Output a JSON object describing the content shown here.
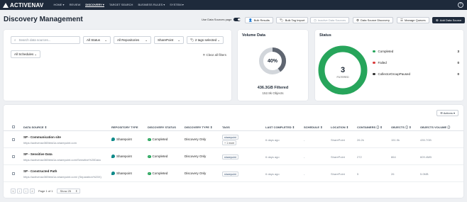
{
  "app": {
    "name": "ACTIVENAV"
  },
  "nav": {
    "items": [
      {
        "label": "HOME ▾"
      },
      {
        "label": "REVIEW"
      },
      {
        "label": "DISCOVERY ▾"
      },
      {
        "label": "TARGET SEARCH"
      },
      {
        "label": "BUSINESS RULES ▾"
      },
      {
        "label": "SYSTEM ▾"
      }
    ],
    "help": "?"
  },
  "header": {
    "title": "Discovery Management",
    "toggle_label": "Use Data Sources page",
    "buttons": {
      "bulk_results": "Bulk Results",
      "bulk_tag_import": "Bulk Tag Import",
      "inactive_data_sources": "Inactive Data Sources",
      "data_source_discovery": "Data Source Discovery",
      "manage_queues": "Manage Queues",
      "add_data_source": "Add Data Source"
    }
  },
  "filters": {
    "search_placeholder": "Search data sources...",
    "status": "All Status",
    "repositories": "All Repositories",
    "sharepoint": "SharePoint",
    "tags": "2 tags selected",
    "schedules": "All Schedules",
    "clear": "✕ Clear all filters"
  },
  "volume": {
    "title": "Volume Data",
    "percent": "40%",
    "filtered": "436.3GB Filtered",
    "objects": "152.9k Objects",
    "fill_fraction": 0.4
  },
  "status": {
    "title": "Status",
    "count": "3",
    "count_label": "FILTERED",
    "items": [
      {
        "label": "Completed",
        "count": "3",
        "color": "#27a55b"
      },
      {
        "label": "Failed",
        "count": "0",
        "color": "#d93b3b"
      },
      {
        "label": "CollectorGroupPaused",
        "count": "0",
        "color": "#333333"
      }
    ]
  },
  "table": {
    "actions": "☰ Actions ▾",
    "headers": {
      "data_source": "DATA SOURCE ⇕",
      "repository_type": "REPOSITORY TYPE",
      "discovery_status": "DISCOVERY STATUS",
      "discovery_type": "DISCOVERY TYPE ⇕",
      "tags": "TAGS",
      "last_completed": "LAST COMPLETED ⇕",
      "schedule": "SCHEDULE ⇕",
      "location": "LOCATION ⇕",
      "containers": "CONTAINERS ⓘ ⇕",
      "objects": "OBJECTS ⓘ ⇕",
      "objects_volume": "OBJECTS VOLUME ⓘ"
    },
    "rows": [
      {
        "name": "SP - Communication site",
        "url": "https://activenav365test1a.sharepoint.com",
        "repo": "Sharepoint",
        "status": "Completed",
        "type": "Discovery Only",
        "tags": [
          "sharepoint",
          "+ 1 more"
        ],
        "last": "6 days ago",
        "schedule": "-",
        "location": "SharePoint",
        "containers": "26.2k",
        "objects": "151.9k",
        "volume": "435.7GB"
      },
      {
        "name": "SP - Sensitive Data",
        "url": "https://activenav365test1a.sharepoint.com/Sensitive%20Data",
        "repo": "Sharepoint",
        "status": "Completed",
        "type": "Discovery Only",
        "tags": [
          "sharepoint"
        ],
        "last": "6 days ago",
        "schedule": "-",
        "location": "SharePoint",
        "containers": "272",
        "objects": "864",
        "volume": "609.4MB"
      },
      {
        "name": "SP - Constructed Path",
        "url": "https://activenav365test1a.sharepoint.com/ (Separation%20X)",
        "repo": "Sharepoint",
        "status": "Completed",
        "type": "Discovery Only",
        "tags": [
          "sharepoint"
        ],
        "last": "6 days ago",
        "schedule": "-",
        "location": "SharePoint",
        "containers": "5",
        "objects": "26",
        "volume": "5.0MB"
      }
    ]
  },
  "pagination": {
    "first": "«",
    "prev": "‹",
    "next": "›",
    "last": "»",
    "page_text": "Page 1 of 1",
    "show": "Show 25"
  }
}
